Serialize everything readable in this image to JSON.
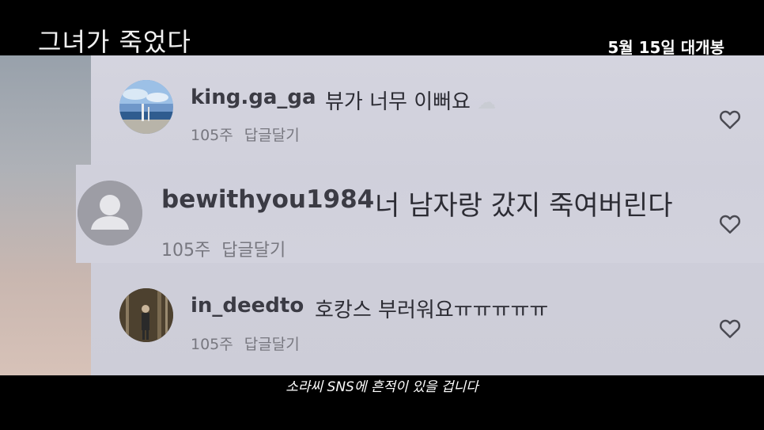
{
  "header": {
    "movie_title": "그녀가 죽었다",
    "release_text": "5월 15일 대개봉"
  },
  "comments": [
    {
      "username": "king.ga_ga",
      "text": "뷰가 너무 이뻐요",
      "emoji": "☁",
      "age": "105주",
      "reply": "답글달기"
    },
    {
      "username": "bewithyou1984",
      "text": "너 남자랑 갔지 죽여버린다",
      "age": "105주",
      "reply": "답글달기"
    },
    {
      "username": "in_deedto",
      "text": "호캉스 부러워요ㅠㅠㅠㅠㅠ",
      "age": "105주",
      "reply": "답글달기"
    }
  ],
  "subtitle": "소라씨 SNS에 흔적이 있을 겁니다",
  "colors": {
    "panel": "#cfcfda",
    "heart": "#4a4a52",
    "text": "#2c2c34"
  }
}
